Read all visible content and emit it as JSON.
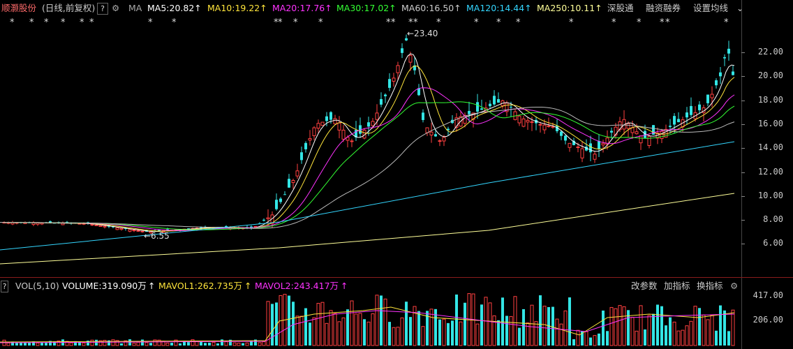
{
  "header": {
    "stock_name": "顺灏股份",
    "period": "(日线,前复权)",
    "help_label": "?",
    "ma_label": "MA",
    "ma_items": [
      {
        "label": "MA5:20.82",
        "arrow": "↑",
        "color": "#ffffff"
      },
      {
        "label": "MA10:19.22",
        "arrow": "↑",
        "color": "#ffe53b"
      },
      {
        "label": "MA20:17.76",
        "arrow": "↑",
        "color": "#ff33ff"
      },
      {
        "label": "MA30:17.02",
        "arrow": "↑",
        "color": "#33ff33"
      },
      {
        "label": "MA60:16.50",
        "arrow": "↑",
        "color": "#cccccc"
      },
      {
        "label": "MA120:14.44",
        "arrow": "↑",
        "color": "#33d6ff"
      },
      {
        "label": "MA250:10.11",
        "arrow": "↑",
        "color": "#ffff99"
      }
    ],
    "links": [
      "深股通",
      "融资融券",
      "设置均线"
    ]
  },
  "price_axis": [
    "22.00",
    "20.00",
    "18.00",
    "16.00",
    "14.00",
    "12.00",
    "10.00",
    "8.00",
    "6.00"
  ],
  "annotations": {
    "high": "←23.40",
    "low": "←6.55"
  },
  "volume_header": {
    "label": "VOL(5,10)",
    "volume": "VOLUME:319.090万",
    "mavol1": "MAVOL1:262.735万",
    "mavol2": "MAVOL2:243.417万",
    "arrow": "↑",
    "tools": [
      "改参数",
      "加指标",
      "换指标"
    ]
  },
  "volume_axis": [
    "417.00",
    "206.00"
  ],
  "colors": {
    "up": "#ff4040",
    "down": "#33e5e5",
    "bg": "#000000"
  }
}
